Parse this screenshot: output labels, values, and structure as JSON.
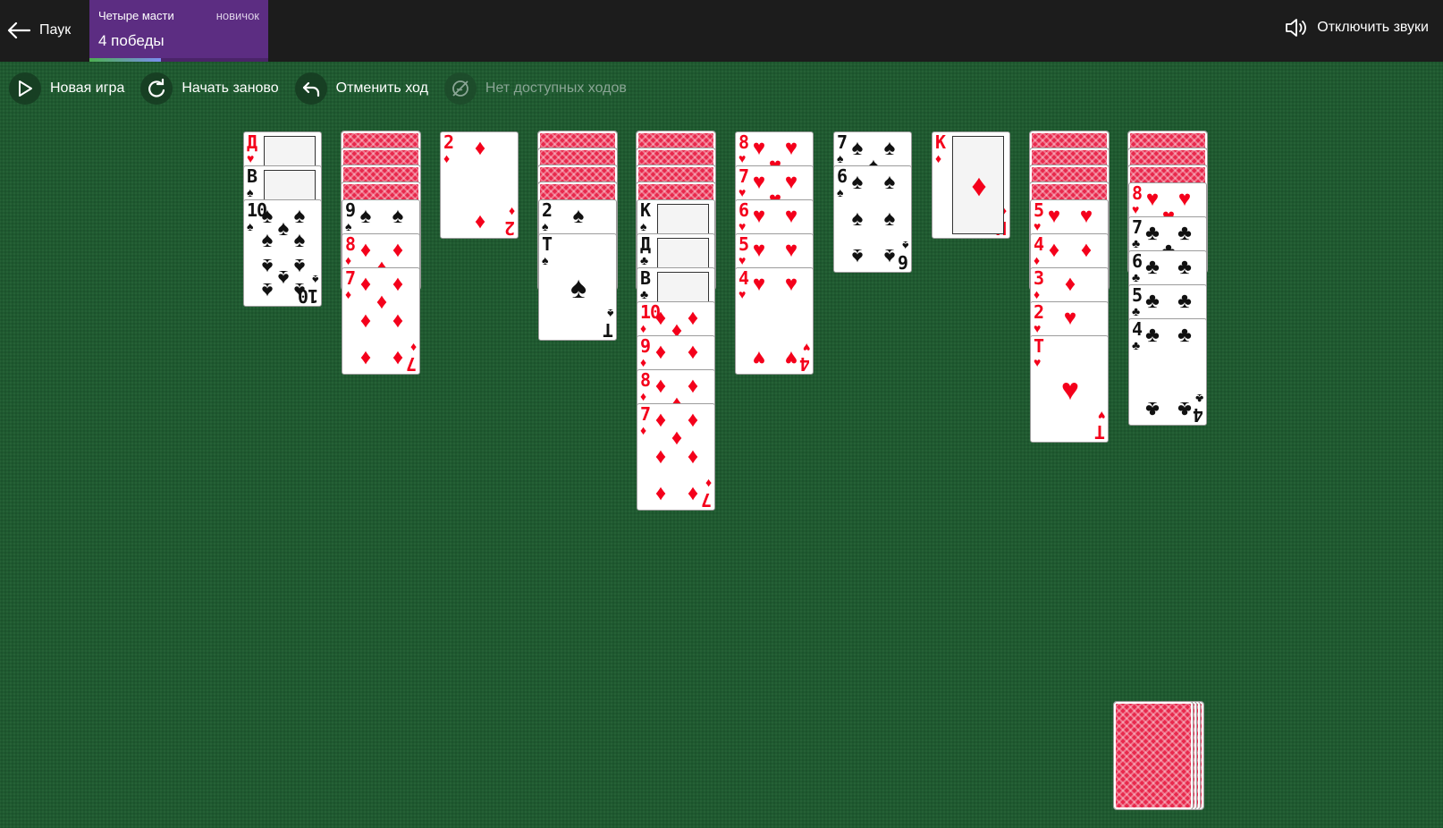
{
  "header": {
    "back_label": "Паук",
    "mode_name": "Четыре масти",
    "mode_level": "новичок",
    "mode_wins": "4 победы",
    "sound_label": "Отключить звуки",
    "progress": 0.4
  },
  "toolbar": {
    "new_game": "Новая игра",
    "restart": "Начать заново",
    "undo": "Отменить ход",
    "no_moves": "Нет доступных ходов"
  },
  "colors": {
    "felt": "#1f5a30",
    "topbar": "#1c1c1c",
    "mode_panel": "#5c2d82",
    "card_back": "#e8294d",
    "red_suit": "#f4001b"
  },
  "tableau": [
    {
      "down": 0,
      "up": [
        {
          "rank": "Д",
          "suit": "♥"
        },
        {
          "rank": "В",
          "suit": "♠"
        },
        {
          "rank": "10",
          "suit": "♠"
        }
      ]
    },
    {
      "down": 4,
      "up": [
        {
          "rank": "9",
          "suit": "♠"
        },
        {
          "rank": "8",
          "suit": "♦"
        },
        {
          "rank": "7",
          "suit": "♦"
        }
      ]
    },
    {
      "down": 0,
      "up": [
        {
          "rank": "2",
          "suit": "♦"
        }
      ]
    },
    {
      "down": 4,
      "up": [
        {
          "rank": "2",
          "suit": "♠"
        },
        {
          "rank": "Т",
          "suit": "♠"
        }
      ]
    },
    {
      "down": 4,
      "up": [
        {
          "rank": "К",
          "suit": "♠"
        },
        {
          "rank": "Д",
          "suit": "♣"
        },
        {
          "rank": "В",
          "suit": "♣"
        },
        {
          "rank": "10",
          "suit": "♦"
        },
        {
          "rank": "9",
          "suit": "♦"
        },
        {
          "rank": "8",
          "suit": "♦"
        },
        {
          "rank": "7",
          "suit": "♦"
        }
      ]
    },
    {
      "down": 0,
      "up": [
        {
          "rank": "8",
          "suit": "♥"
        },
        {
          "rank": "7",
          "suit": "♥"
        },
        {
          "rank": "6",
          "suit": "♥"
        },
        {
          "rank": "5",
          "suit": "♥"
        },
        {
          "rank": "4",
          "suit": "♥"
        }
      ]
    },
    {
      "down": 0,
      "up": [
        {
          "rank": "7",
          "suit": "♠"
        },
        {
          "rank": "6",
          "suit": "♠"
        }
      ]
    },
    {
      "down": 0,
      "up": [
        {
          "rank": "К",
          "suit": "♦"
        }
      ]
    },
    {
      "down": 4,
      "up": [
        {
          "rank": "5",
          "suit": "♥"
        },
        {
          "rank": "4",
          "suit": "♦"
        },
        {
          "rank": "3",
          "suit": "♦"
        },
        {
          "rank": "2",
          "suit": "♥"
        },
        {
          "rank": "Т",
          "suit": "♥"
        }
      ]
    },
    {
      "down": 3,
      "up": [
        {
          "rank": "8",
          "suit": "♥"
        },
        {
          "rank": "7",
          "suit": "♣"
        },
        {
          "rank": "6",
          "suit": "♣"
        },
        {
          "rank": "5",
          "suit": "♣"
        },
        {
          "rank": "4",
          "suit": "♣"
        }
      ]
    }
  ],
  "stock": {
    "remaining_deals": 4
  }
}
